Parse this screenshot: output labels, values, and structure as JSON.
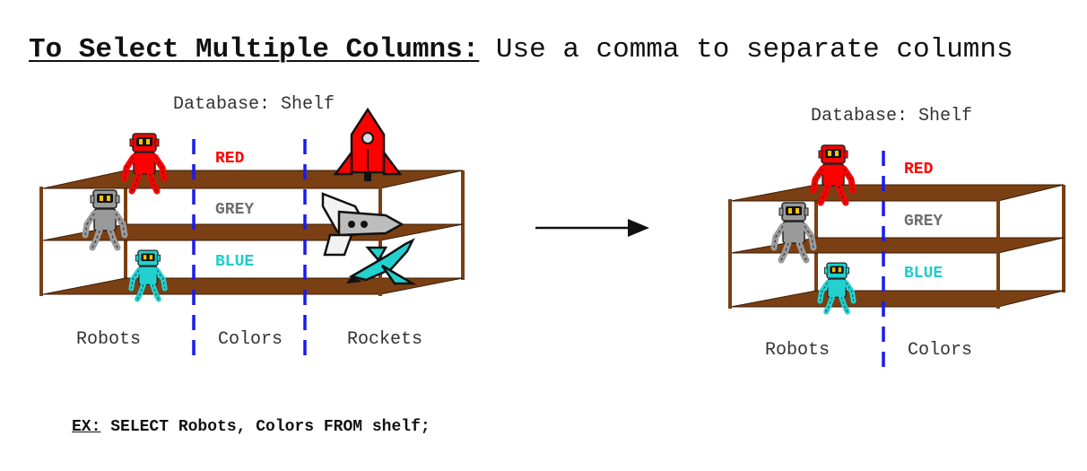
{
  "title": {
    "heading": "To Select Multiple Columns:",
    "description": "Use a comma to separate columns"
  },
  "left_diagram": {
    "database_label": "Database: Shelf",
    "rows": [
      "RED",
      "GREY",
      "BLUE"
    ],
    "columns": [
      "Robots",
      "Colors",
      "Rockets"
    ]
  },
  "right_diagram": {
    "database_label": "Database: Shelf",
    "rows": [
      "RED",
      "GREY",
      "BLUE"
    ],
    "columns": [
      "Robots",
      "Colors"
    ]
  },
  "example": {
    "prefix": "EX:",
    "query": "SELECT Robots, Colors FROM shelf;"
  },
  "colors": {
    "red": "#ff0000",
    "grey": "#6e6e6e",
    "blue": "#22cccc",
    "wood": "#7a3f12",
    "divider": "#1a1aee"
  }
}
